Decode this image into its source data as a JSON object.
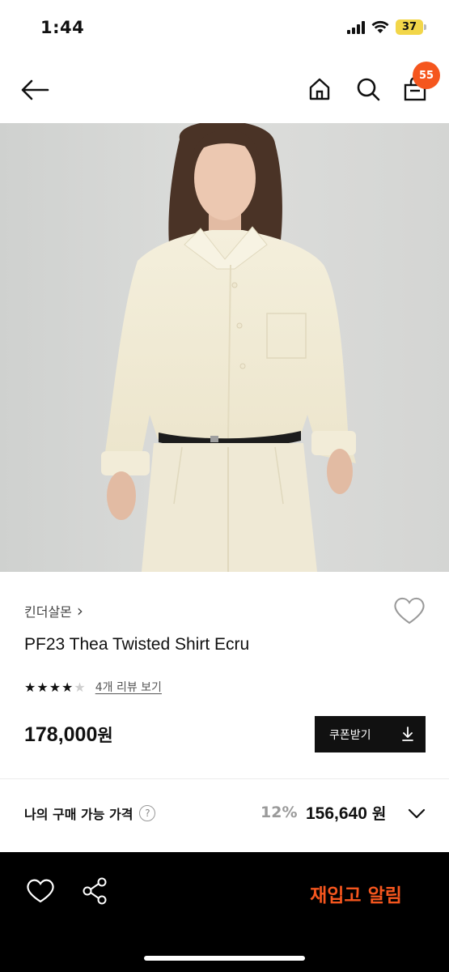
{
  "status_bar": {
    "time": "1:44",
    "battery": "37"
  },
  "nav": {
    "back_icon": "arrow-left-icon",
    "home_icon": "home-icon",
    "search_icon": "search-icon",
    "cart_icon": "shopping-bag-icon",
    "cart_count": "55"
  },
  "product": {
    "brand": "킨더살몬",
    "brand_chevron": "›",
    "title": "PF23 Thea Twisted Shirt Ecru",
    "rating_stars": 4,
    "rating_max": 5,
    "review_link": "4개 리뷰 보기",
    "price": "178,000",
    "price_unit": "원",
    "coupon_label": "쿠폰받기"
  },
  "my_price": {
    "label": "나의 구매 가능 가격",
    "help_symbol": "?",
    "discount": "12%",
    "price": "156,640",
    "unit": "원"
  },
  "bottom_bar": {
    "restock_label": "재입고 알림"
  },
  "colors": {
    "accent": "#f5561e",
    "dark": "#111111",
    "battery": "#f2d649"
  }
}
